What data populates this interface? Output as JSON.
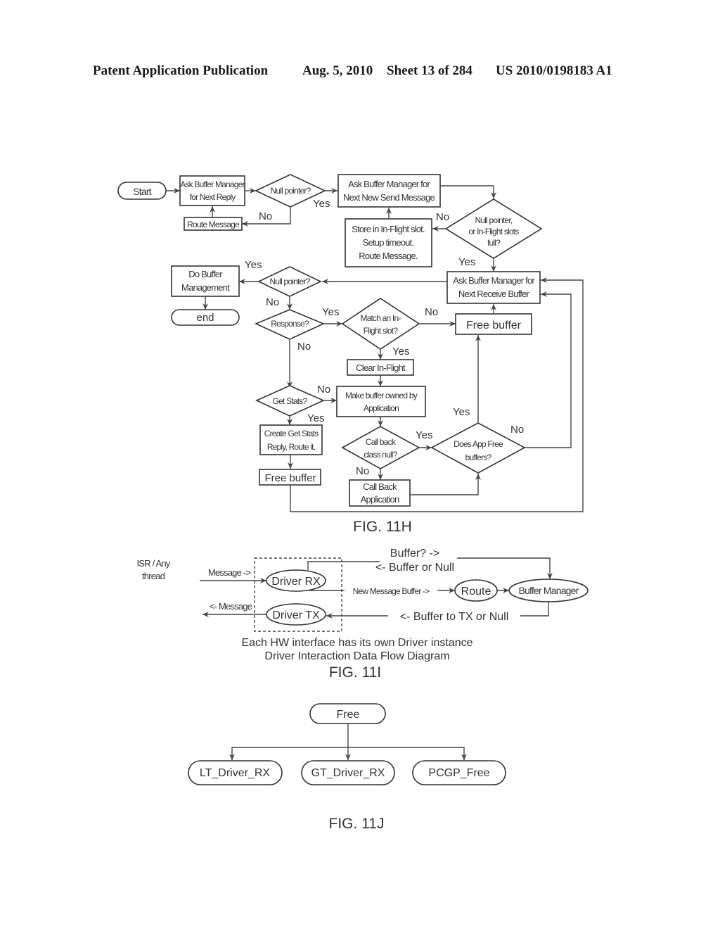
{
  "header": {
    "left": "Patent Application Publication",
    "date": "Aug. 5, 2010",
    "sheet": "Sheet 13 of 284",
    "pub_number": "US 2010/0198183 A1"
  },
  "fig11h": {
    "caption": "FIG. 11H",
    "start": "Start",
    "ask_reply": [
      "Ask Buffer Manager",
      "for Next Reply"
    ],
    "null1": "Null pointer?",
    "route_msg": "Route Message",
    "ask_send": [
      "Ask Buffer Manager for",
      "Next New Send Message"
    ],
    "null2": [
      "Null pointer,",
      "or In-Flight slots",
      "full?"
    ],
    "store": [
      "Store in In-Flight slot.",
      "Setup timeout.",
      "Route Message."
    ],
    "ask_recv": [
      "Ask Buffer Manager for",
      "Next Receive Buffer"
    ],
    "null3": "Null pointer?",
    "do_buffer": [
      "Do Buffer",
      "Management"
    ],
    "end": "end",
    "response": "Response?",
    "match": [
      "Match an In-",
      "Flight slot?"
    ],
    "free_buffer_top": "Free buffer",
    "clear": "Clear In-Flight",
    "get_stats": "Get Stats?",
    "make_owned": [
      "Make buffer owned by",
      "Application"
    ],
    "create_stats": [
      "Create Get Stats",
      "Reply, Route it."
    ],
    "callback_null": [
      "Call back",
      "class null?"
    ],
    "app_free": [
      "Does App Free",
      "buffers?"
    ],
    "free_buffer_bottom": "Free buffer",
    "call_back_app": [
      "Call Back",
      "Application"
    ],
    "labels": {
      "yes": "Yes",
      "no": "No"
    }
  },
  "fig11i": {
    "caption": "FIG. 11I",
    "isr": [
      "ISR / Any",
      "thread"
    ],
    "message_in": "Message ->",
    "message_out": "<- Message",
    "driver_rx": "Driver RX",
    "driver_tx": "Driver TX",
    "buffer_q": "Buffer? ->",
    "buffer_or_null": "<- Buffer or Null",
    "new_msg_buffer": "New Message Buffer ->",
    "route": "Route",
    "buffer_manager": "Buffer Manager",
    "buffer_to_tx": "<- Buffer to TX or Null",
    "note1": "Each HW interface has its own Driver instance",
    "note2": "Driver Interaction Data Flow Diagram"
  },
  "fig11j": {
    "caption": "FIG. 11J",
    "root": "Free",
    "children": [
      "LT_Driver_RX",
      "GT_Driver_RX",
      "PCGP_Free"
    ]
  }
}
